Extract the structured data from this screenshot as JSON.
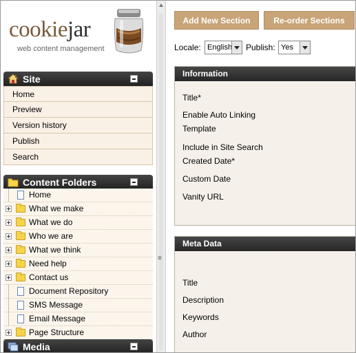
{
  "logo": {
    "word_part1": "cookie",
    "word_part2": "jar",
    "subtitle": "web content management"
  },
  "site_panel": {
    "title": "Site",
    "items": [
      "Home",
      "Preview",
      "Version history",
      "Publish",
      "Search"
    ]
  },
  "folders_panel": {
    "title": "Content Folders",
    "items": [
      {
        "label": "Home",
        "kind": "doc",
        "expandable": false
      },
      {
        "label": "What we make",
        "kind": "folder",
        "expandable": true
      },
      {
        "label": "What we do",
        "kind": "folder",
        "expandable": true
      },
      {
        "label": "Who we are",
        "kind": "folder",
        "expandable": true
      },
      {
        "label": "What we think",
        "kind": "folder",
        "expandable": true
      },
      {
        "label": "Need help",
        "kind": "folder",
        "expandable": true
      },
      {
        "label": "Contact us",
        "kind": "folder",
        "expandable": true
      },
      {
        "label": "Document Repository",
        "kind": "doc",
        "expandable": false
      },
      {
        "label": "SMS Message",
        "kind": "doc",
        "expandable": false
      },
      {
        "label": "Email Message",
        "kind": "doc",
        "expandable": false
      },
      {
        "label": "Page Structure",
        "kind": "folder",
        "expandable": true
      }
    ]
  },
  "media_panel": {
    "title": "Media"
  },
  "toolbar": {
    "add_label": "Add New Section",
    "reorder_label": "Re-order Sections"
  },
  "locale": {
    "locale_label": "Locale:",
    "locale_value": "English",
    "publish_label": "Publish:",
    "publish_value": "Yes"
  },
  "information": {
    "title": "Information",
    "fields": [
      "Title*",
      "Enable Auto Linking",
      "Template",
      "Include in Site Search",
      "Created Date*",
      "Custom Date",
      "Vanity URL"
    ]
  },
  "meta": {
    "title": "Meta Data",
    "fields": [
      "Title",
      "Description",
      "Keywords",
      "Author"
    ]
  },
  "colors": {
    "button_bg": "#c8a478",
    "panel_header": "#2b2b2b",
    "list_bg": "#faf1e6",
    "box_bg": "#f5f1ea"
  }
}
